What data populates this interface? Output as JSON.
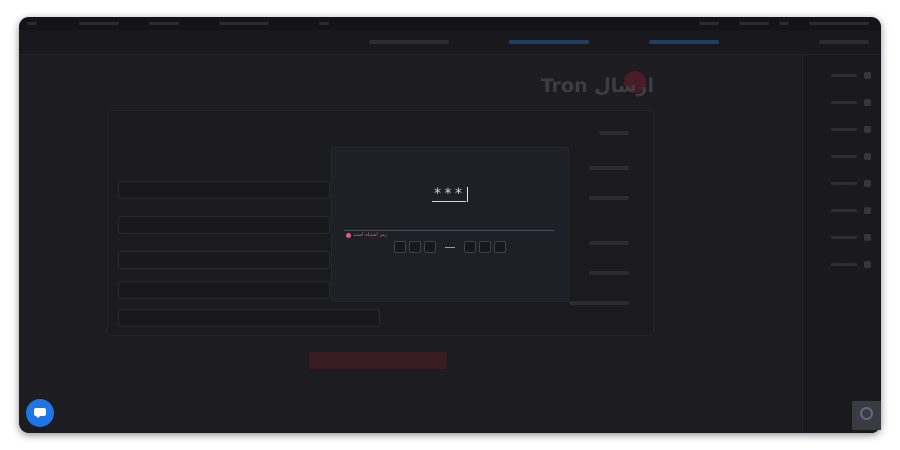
{
  "modal": {
    "password_value": "***",
    "error_message": "رمز اشتباه است",
    "otp_left": [
      "",
      "",
      ""
    ],
    "otp_right": [
      "",
      "",
      ""
    ]
  },
  "page": {
    "title": "ارسال Tron"
  },
  "colors": {
    "accent_blue": "#1e75e6",
    "error_pink": "#e55b7a",
    "modal_bg": "#1e2027",
    "page_bg": "#1d1d21"
  },
  "icons": {
    "chat": "chat-bubble-icon",
    "recaptcha": "recaptcha-icon",
    "coin": "tron-coin-icon",
    "error": "error-dot-icon"
  }
}
